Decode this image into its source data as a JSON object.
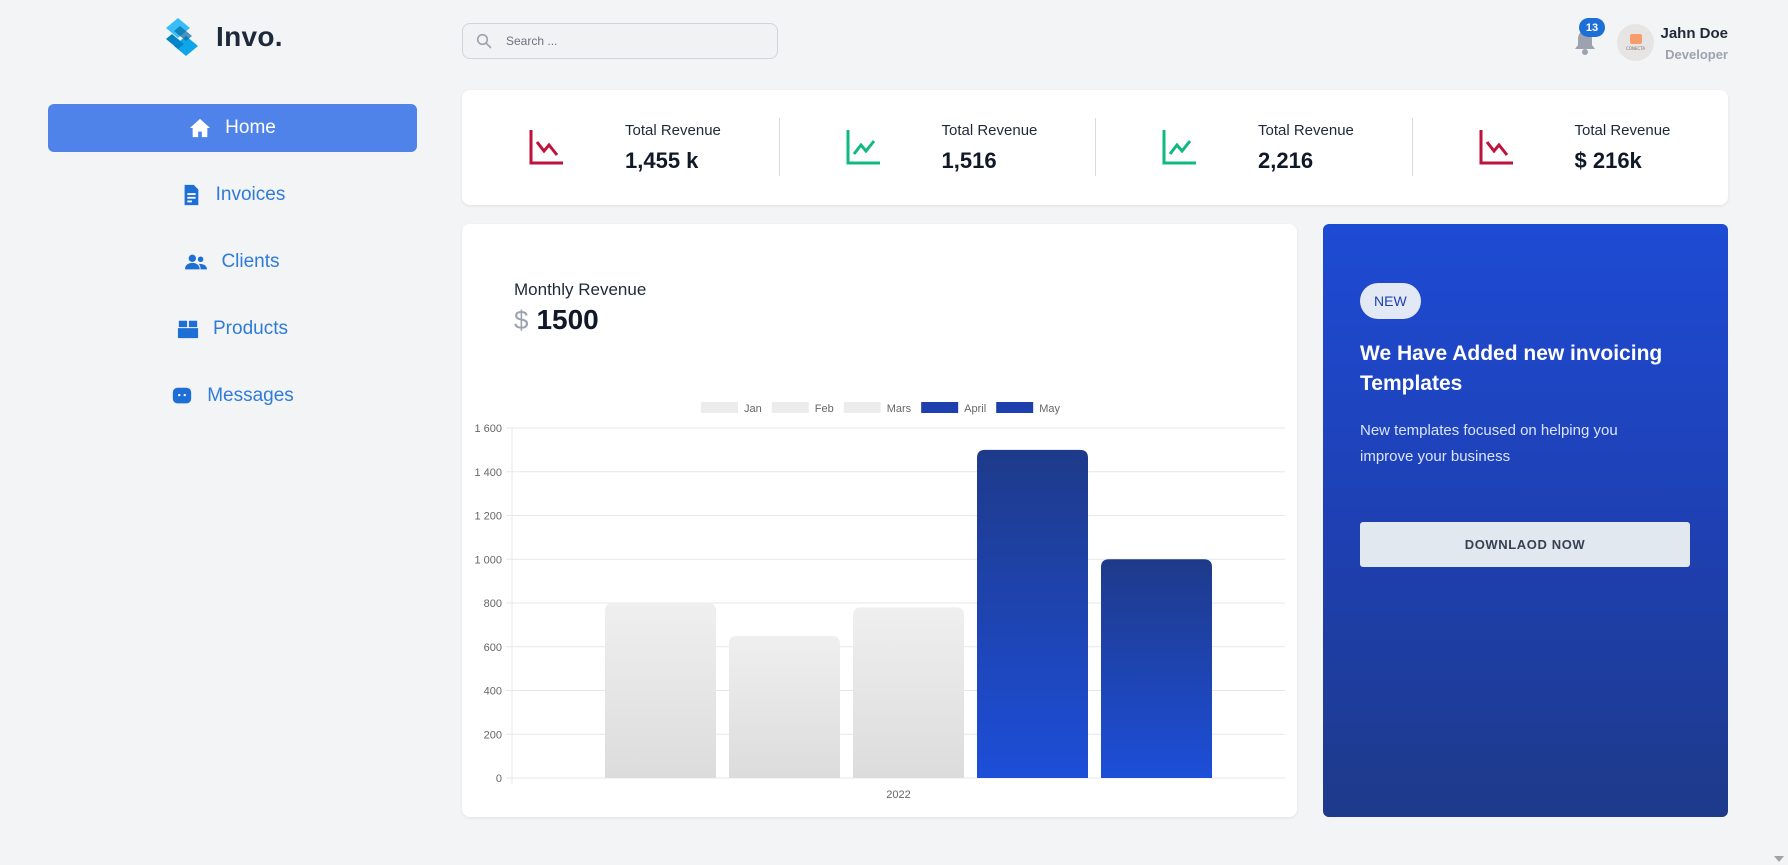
{
  "brand": {
    "name": "Invo.",
    "logo_icon": "diamond-logo-icon"
  },
  "sidebar": {
    "items": [
      {
        "label": "Home",
        "icon": "home-icon",
        "active": true
      },
      {
        "label": "Invoices",
        "icon": "invoice-icon",
        "active": false
      },
      {
        "label": "Clients",
        "icon": "users-icon",
        "active": false
      },
      {
        "label": "Products",
        "icon": "box-icon",
        "active": false
      },
      {
        "label": "Messages",
        "icon": "message-icon",
        "active": false
      }
    ]
  },
  "search": {
    "placeholder": "Search ...",
    "value": ""
  },
  "header": {
    "notifications": {
      "count": "13",
      "icon": "bell-icon"
    },
    "user": {
      "name": "Jahn Doe",
      "role": "Developer",
      "avatar_text": "CONECTA"
    }
  },
  "stats": [
    {
      "label": "Total Revenue",
      "value": "1,455 k",
      "trend": "down",
      "color": "#be123c"
    },
    {
      "label": "Total Revenue",
      "value": "1,516",
      "trend": "up",
      "color": "#10b981"
    },
    {
      "label": "Total Revenue",
      "value": "2,216",
      "trend": "up",
      "color": "#10b981"
    },
    {
      "label": "Total Revenue",
      "value": "$ 216k",
      "trend": "down",
      "color": "#be123c"
    }
  ],
  "revenue": {
    "title": "Monthly Revenue",
    "currency": "$",
    "value": "1500"
  },
  "chart_data": {
    "type": "bar",
    "categories": [
      "2022"
    ],
    "series": [
      {
        "name": "Jan",
        "values": [
          800
        ],
        "color": "#e5e5e5"
      },
      {
        "name": "Feb",
        "values": [
          650
        ],
        "color": "#e5e5e5"
      },
      {
        "name": "Mars",
        "values": [
          780
        ],
        "color": "#e5e5e5"
      },
      {
        "name": "April",
        "values": [
          1500
        ],
        "color": "#1e40af"
      },
      {
        "name": "May",
        "values": [
          1000
        ],
        "color": "#1e40af"
      }
    ],
    "yticks": [
      "0",
      "200",
      "400",
      "600",
      "800",
      "1 000",
      "1 200",
      "1 400",
      "1 600"
    ],
    "ylim": [
      0,
      1600
    ],
    "grid": true,
    "legend_position": "top-center",
    "title": "",
    "xlabel": "",
    "ylabel": ""
  },
  "promo": {
    "badge": "NEW",
    "title": "We Have Added new invoicing Templates",
    "text": "New templates focused on helping you improve your business",
    "button": "DOWNLAOD NOW"
  }
}
